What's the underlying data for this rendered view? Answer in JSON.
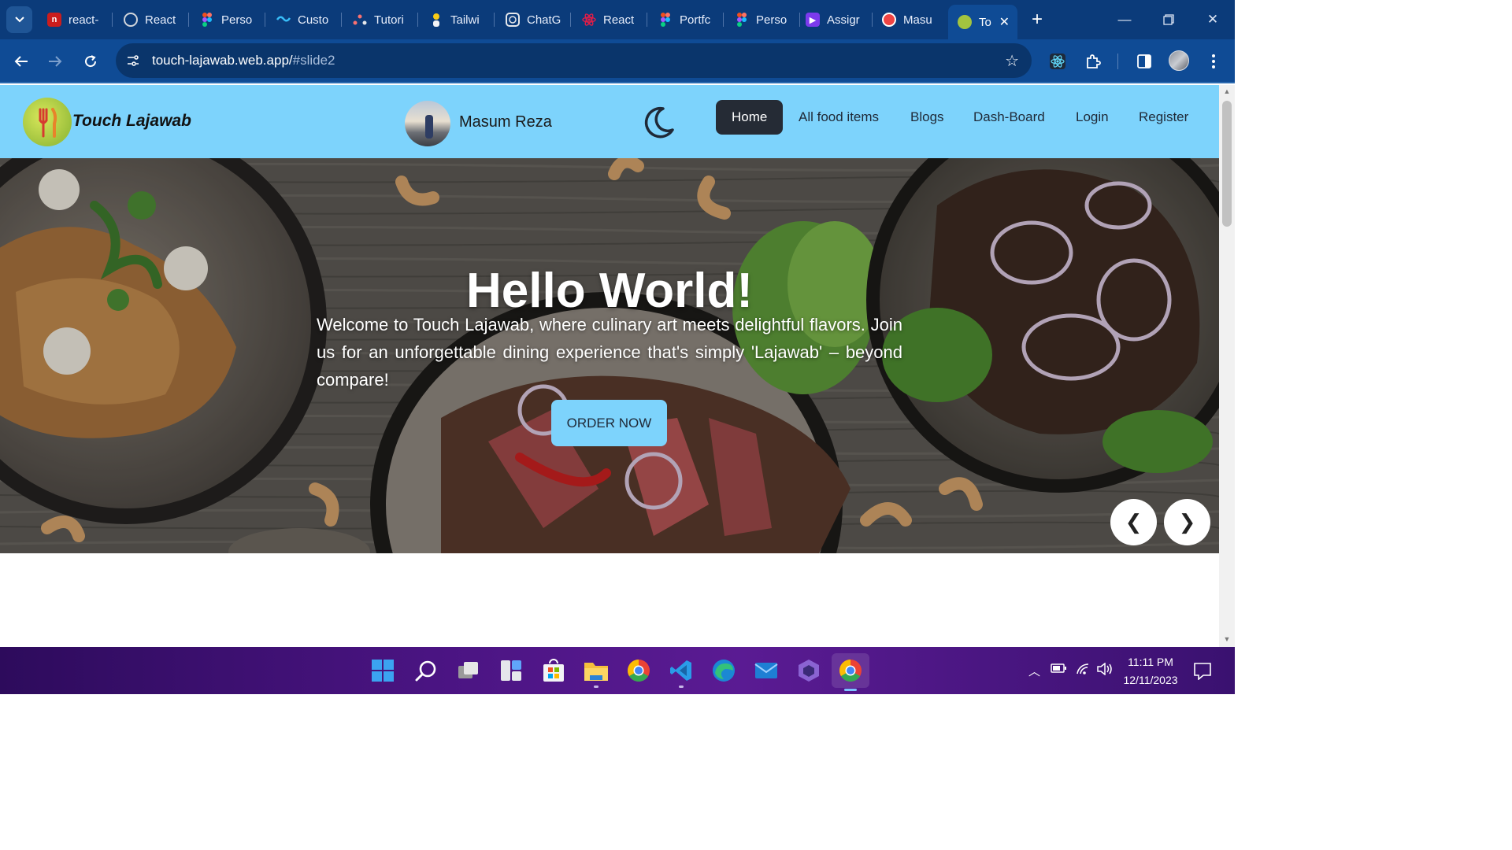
{
  "browser": {
    "tabs": [
      {
        "label": "react-",
        "favicon": "n-icon",
        "color": "#cb1d1d"
      },
      {
        "label": "React",
        "favicon": "globe-icon",
        "color": "#6b7280"
      },
      {
        "label": "Perso",
        "favicon": "figma-icon",
        "color": "#f24e1e"
      },
      {
        "label": "Custo",
        "favicon": "tailwind-icon",
        "color": "#38bdf8"
      },
      {
        "label": "Tutori",
        "favicon": "tutorial-icon",
        "color": "#e5e7eb"
      },
      {
        "label": "Tailwi",
        "favicon": "person-icon",
        "color": "#facc15"
      },
      {
        "label": "ChatG",
        "favicon": "chatgpt-icon",
        "color": "#10a37f"
      },
      {
        "label": "React",
        "favicon": "react-icon",
        "color": "#e11d48"
      },
      {
        "label": "Portfc",
        "favicon": "figma-icon",
        "color": "#f24e1e"
      },
      {
        "label": "Perso",
        "favicon": "figma-icon",
        "color": "#f24e1e"
      },
      {
        "label": "Assigr",
        "favicon": "assignment-icon",
        "color": "#7c3aed"
      },
      {
        "label": "Masu",
        "favicon": "avatar-icon",
        "color": "#ef4444"
      },
      {
        "label": "To",
        "favicon": "touch-lajawab-icon",
        "color": "#a3c43f",
        "active": true
      }
    ],
    "url": {
      "host": "touch-lajawab.web.app/",
      "hash": "#slide2"
    }
  },
  "site": {
    "brand": "Touch Lajawab",
    "user_name": "Masum Reza",
    "nav": [
      {
        "label": "Home",
        "active": true
      },
      {
        "label": "All food items"
      },
      {
        "label": "Blogs"
      },
      {
        "label": "Dash-Board"
      },
      {
        "label": "Login"
      },
      {
        "label": "Register"
      }
    ],
    "accent": "#7dd3fc"
  },
  "hero": {
    "title": "Hello World!",
    "text": "Welcome to Touch Lajawab, where culinary art meets delightful flavors. Join us for an unforgettable dining experience that's simply 'Lajawab' – beyond compare!",
    "cta": "ORDER NOW",
    "prev": "❮",
    "next": "❯"
  },
  "taskbar": {
    "time": "11:11 PM",
    "date": "12/11/2023",
    "apps": [
      "start-icon",
      "search-icon",
      "task-view-icon",
      "widgets-icon",
      "store-icon",
      "file-explorer-icon",
      "chrome-icon",
      "vscode-icon",
      "edge-icon",
      "mail-icon",
      "app-icon",
      "chrome-icon"
    ]
  }
}
